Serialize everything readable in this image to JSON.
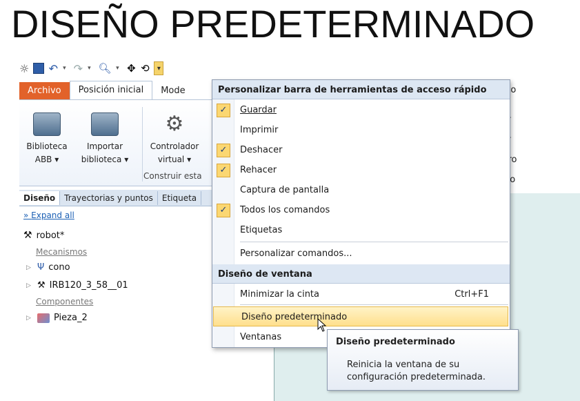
{
  "heading": "DISEÑO PREDETERMINADO",
  "qat": {
    "icons": [
      "app-icon",
      "save-icon",
      "undo-icon",
      "redo-icon",
      "zoom-icon",
      "move-icon",
      "rotate-icon",
      "customize-icon"
    ]
  },
  "ribbon_tabs": {
    "archivo": "Archivo",
    "posicion_inicial": "Posición inicial",
    "modelado": "Mode"
  },
  "ribbon": {
    "biblioteca_abb": [
      "Biblioteca",
      "ABB ▾"
    ],
    "importar_biblioteca": [
      "Importar",
      "biblioteca ▾"
    ],
    "controlador_virtual": [
      "Controlador",
      "virtual ▾"
    ],
    "group_label": "Construir esta"
  },
  "right_partial": [
    "nto",
    "gr",
    "gr",
    "r ro",
    "cto"
  ],
  "panel_tabs": [
    "Diseño",
    "Trayectorias y puntos",
    "Etiqueta"
  ],
  "tree": {
    "expand_all": "Expand all",
    "station": "robot*",
    "mechanisms_label": "Mecanismos",
    "mechanisms": [
      "cono",
      "IRB120_3_58__01"
    ],
    "components_label": "Componentes",
    "components": [
      "Pieza_2"
    ]
  },
  "menu": {
    "section1": "Personalizar barra de herramientas de acceso rápido",
    "items1": [
      {
        "label": "Guardar",
        "checked": true
      },
      {
        "label": "Imprimir",
        "checked": false
      },
      {
        "label": "Deshacer",
        "checked": true
      },
      {
        "label": "Rehacer",
        "checked": true
      },
      {
        "label": "Captura de pantalla",
        "checked": false
      },
      {
        "label": "Todos los comandos",
        "checked": true
      },
      {
        "label": "Etiquetas",
        "checked": false
      }
    ],
    "personalizar": "Personalizar comandos...",
    "section2": "Diseño de ventana",
    "minimizar": "Minimizar la cinta",
    "minimizar_shortcut": "Ctrl+F1",
    "diseno_predeterminado": "Diseño predeterminado",
    "ventanas": "Ventanas"
  },
  "tooltip": {
    "title": "Diseño predeterminado",
    "body_line1": "Reinicia la ventana de su",
    "body_line2": "configuración predeterminada."
  },
  "colors": {
    "archivo_tab": "#e2622a",
    "highlight": "#ffdf8c",
    "check_bg": "#fbd772"
  }
}
